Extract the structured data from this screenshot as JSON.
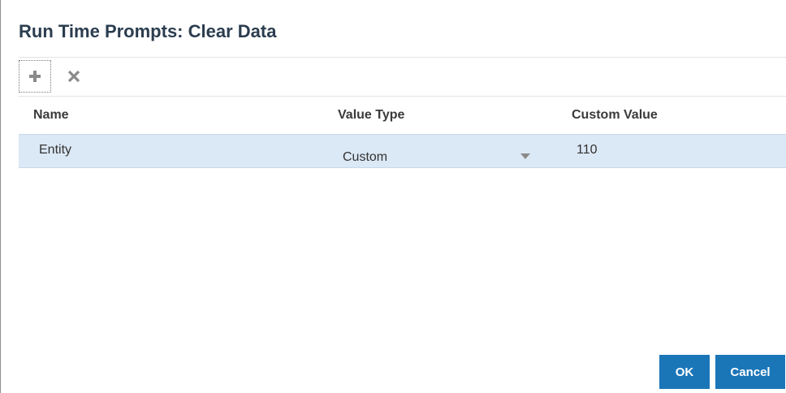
{
  "dialog": {
    "title": "Run Time Prompts: Clear Data"
  },
  "toolbar": {
    "add_icon": "plus-icon",
    "delete_icon": "close-x-icon"
  },
  "table": {
    "columns": [
      "Name",
      "Value Type",
      "Custom Value"
    ],
    "rows": [
      {
        "name": "Entity",
        "value_type": "Custom",
        "custom_value": "110"
      }
    ]
  },
  "footer": {
    "ok_label": "OK",
    "cancel_label": "Cancel"
  },
  "colors": {
    "accent": "#1b76b8",
    "selected_row": "#dbe8f5",
    "title": "#2b3d4f"
  }
}
